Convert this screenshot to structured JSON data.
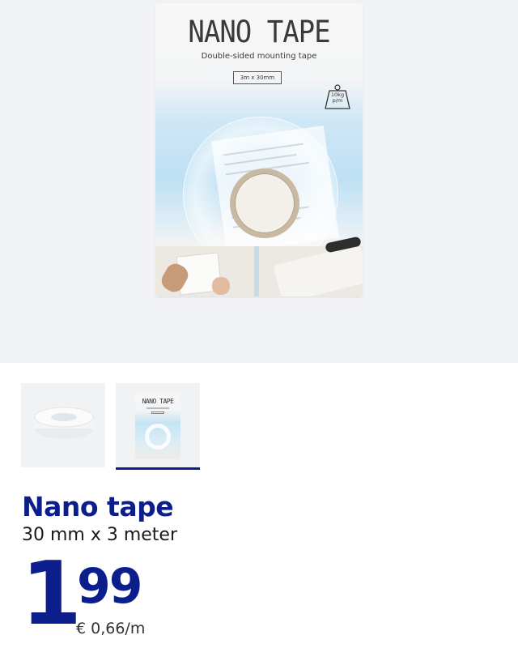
{
  "hero_image": {
    "package_title": "NANO TAPE",
    "package_subtitle": "Double-sided mounting tape",
    "package_size": "3m x 30mm",
    "weight_badge_line1": "10kg",
    "weight_badge_line2": "p/m",
    "icon": "weight-icon"
  },
  "thumbnails": [
    {
      "name": "tape-roll-thumbnail",
      "selected": false
    },
    {
      "name": "package-thumbnail",
      "selected": true,
      "mini_title": "NANO TAPE"
    }
  ],
  "product": {
    "title": "Nano tape",
    "subtitle": "30 mm x 3 meter",
    "price_whole": "1",
    "price_decimal": "99",
    "unit_price": "€ 0,66/m"
  },
  "colors": {
    "brand_blue": "#0c1e8c",
    "hero_background": "#f1f2f4",
    "package_blue": "#bfe0f4"
  }
}
